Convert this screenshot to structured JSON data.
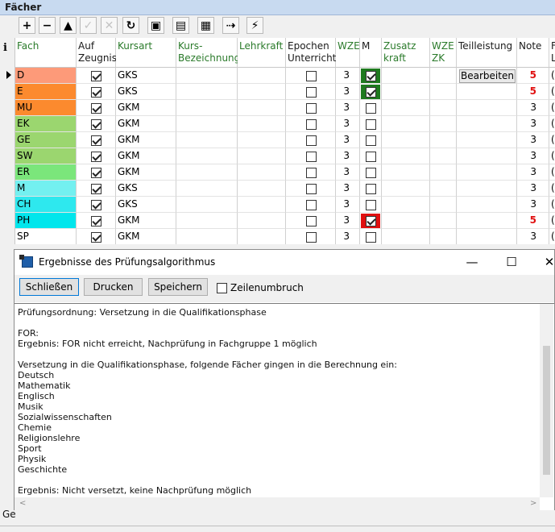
{
  "window": {
    "title": "Fächer"
  },
  "toolbar": {
    "buttons": [
      {
        "name": "add-button",
        "glyph": "+",
        "enabled": true
      },
      {
        "name": "remove-button",
        "glyph": "−",
        "enabled": true
      },
      {
        "name": "up-button",
        "glyph": "▲",
        "enabled": true
      },
      {
        "name": "confirm-button",
        "glyph": "✓",
        "enabled": false
      },
      {
        "name": "cancel-button",
        "glyph": "✕",
        "enabled": false
      },
      {
        "name": "refresh-button",
        "glyph": "↻",
        "enabled": true
      },
      {
        "name": "delete-record-button",
        "glyph": "▣",
        "enabled": true
      },
      {
        "name": "copy-button",
        "glyph": "▤",
        "enabled": true
      },
      {
        "name": "form-button",
        "glyph": "▦",
        "enabled": true
      },
      {
        "name": "export-button",
        "glyph": "⇢",
        "enabled": true
      },
      {
        "name": "run-algorithm-button",
        "glyph": "⚡",
        "enabled": true
      }
    ]
  },
  "grid": {
    "info_label": "i",
    "headers": {
      "fach": "Fach",
      "zeugnis": "Auf Zeugnis",
      "kursart": "Kursart",
      "kursbez": "Kurs-Bezeichnung",
      "lehrkraft": "Lehrkraft",
      "epochen": "Epochen Unterricht",
      "wze": "WZE",
      "m": "M",
      "zusatz": "Zusatz kraft",
      "wzezk": "WZE ZK",
      "teilleistung": "Teilleistung",
      "note": "Note",
      "extra": "F L"
    },
    "teilleistung_button": "Bearbeiten",
    "rows": [
      {
        "fach": "D",
        "color": "#fd9a79",
        "zeugnis": true,
        "kursart": "GKS",
        "epochen": false,
        "wze": "3",
        "m": "green",
        "note": "5",
        "note_red": true,
        "extra": "("
      },
      {
        "fach": "E",
        "color": "#fc8a2e",
        "zeugnis": true,
        "kursart": "GKS",
        "epochen": false,
        "wze": "3",
        "m": "green",
        "note": "5",
        "note_red": true,
        "extra": "("
      },
      {
        "fach": "MU",
        "color": "#fc8a2e",
        "zeugnis": true,
        "kursart": "GKM",
        "epochen": false,
        "wze": "3",
        "m": "off",
        "note": "3",
        "note_red": false,
        "extra": "("
      },
      {
        "fach": "EK",
        "color": "#9bd66f",
        "zeugnis": true,
        "kursart": "GKM",
        "epochen": false,
        "wze": "3",
        "m": "off",
        "note": "3",
        "note_red": false,
        "extra": "("
      },
      {
        "fach": "GE",
        "color": "#9bd66f",
        "zeugnis": true,
        "kursart": "GKM",
        "epochen": false,
        "wze": "3",
        "m": "off",
        "note": "3",
        "note_red": false,
        "extra": "("
      },
      {
        "fach": "SW",
        "color": "#9bd66f",
        "zeugnis": true,
        "kursart": "GKM",
        "epochen": false,
        "wze": "3",
        "m": "off",
        "note": "3",
        "note_red": false,
        "extra": "("
      },
      {
        "fach": "ER",
        "color": "#7be67b",
        "zeugnis": true,
        "kursart": "GKM",
        "epochen": false,
        "wze": "3",
        "m": "off",
        "note": "3",
        "note_red": false,
        "extra": "("
      },
      {
        "fach": "M",
        "color": "#73f0f0",
        "zeugnis": true,
        "kursart": "GKS",
        "epochen": false,
        "wze": "3",
        "m": "off",
        "note": "3",
        "note_red": false,
        "extra": "("
      },
      {
        "fach": "CH",
        "color": "#2ee8ee",
        "zeugnis": true,
        "kursart": "GKS",
        "epochen": false,
        "wze": "3",
        "m": "off",
        "note": "3",
        "note_red": false,
        "extra": "("
      },
      {
        "fach": "PH",
        "color": "#00e6ec",
        "zeugnis": true,
        "kursart": "GKM",
        "epochen": false,
        "wze": "3",
        "m": "red",
        "note": "5",
        "note_red": true,
        "extra": "("
      },
      {
        "fach": "SP",
        "color": "#ffffff",
        "zeugnis": true,
        "kursart": "GKM",
        "epochen": false,
        "wze": "3",
        "m": "off",
        "note": "3",
        "note_red": false,
        "extra": "("
      }
    ]
  },
  "dialog": {
    "title": "Ergebnisse des Prüfungsalgorithmus",
    "buttons": {
      "close": "Schließen",
      "print": "Drucken",
      "save": "Speichern"
    },
    "wrap_label": "Zeilenumbruch",
    "wrap_checked": false,
    "lines": [
      "Prüfungsordnung: Versetzung in die Qualifikationsphase",
      "",
      "FOR:",
      "Ergebnis: FOR nicht erreicht, Nachprüfung in Fachgruppe 1 möglich",
      "",
      "Versetzung in die Qualifikationsphase, folgende Fächer gingen in die Berechnung ein:",
      "Deutsch",
      "Mathematik",
      "Englisch",
      "Musik",
      "Sozialwissenschaften",
      "Chemie",
      "Religionslehre",
      "Sport",
      "Physik",
      "Geschichte",
      "",
      "Ergebnis: Nicht versetzt, keine Nachprüfung möglich"
    ]
  },
  "status": {
    "left_fragment": "Ge",
    "bottom_text": ""
  }
}
